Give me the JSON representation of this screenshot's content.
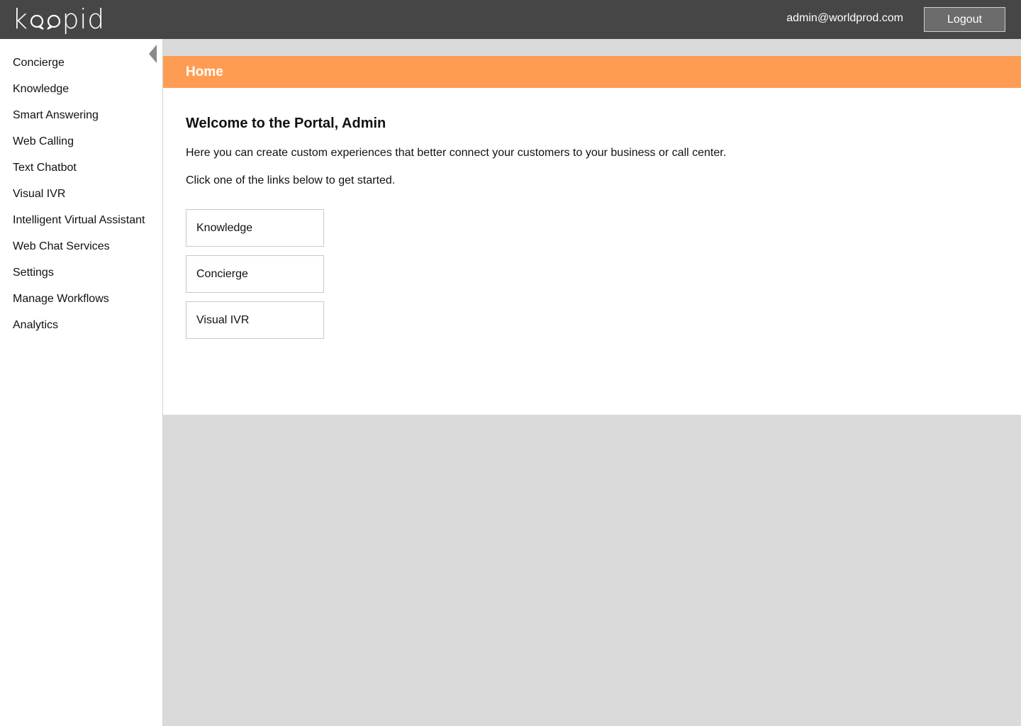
{
  "header": {
    "logo_text_left": "k",
    "logo_text_right": "pid",
    "user_email": "admin@worldprod.com",
    "logout_label": "Logout"
  },
  "sidebar": {
    "items": [
      {
        "label": "Concierge"
      },
      {
        "label": "Knowledge"
      },
      {
        "label": "Smart Answering"
      },
      {
        "label": "Web Calling"
      },
      {
        "label": "Text Chatbot"
      },
      {
        "label": "Visual IVR"
      },
      {
        "label": "Intelligent Virtual Assistant"
      },
      {
        "label": "Web Chat Services"
      },
      {
        "label": "Settings"
      },
      {
        "label": "Manage Workflows"
      },
      {
        "label": "Analytics"
      }
    ]
  },
  "main": {
    "page_title": "Home",
    "welcome": "Welcome to the Portal, Admin",
    "intro": "Here you can create custom experiences that better connect your customers to your business or call center.",
    "instruction": "Click one of the links below to get started.",
    "quick_links": [
      {
        "label": "Knowledge"
      },
      {
        "label": "Concierge"
      },
      {
        "label": "Visual IVR"
      }
    ]
  },
  "colors": {
    "topbar": "#464646",
    "accent": "#ff9c54",
    "content_background": "#dadada",
    "logout_button": "#6c6c6c"
  },
  "icons": {
    "collapse": "caret-left-icon",
    "logo_bubbles": "speech-bubble-icon"
  }
}
